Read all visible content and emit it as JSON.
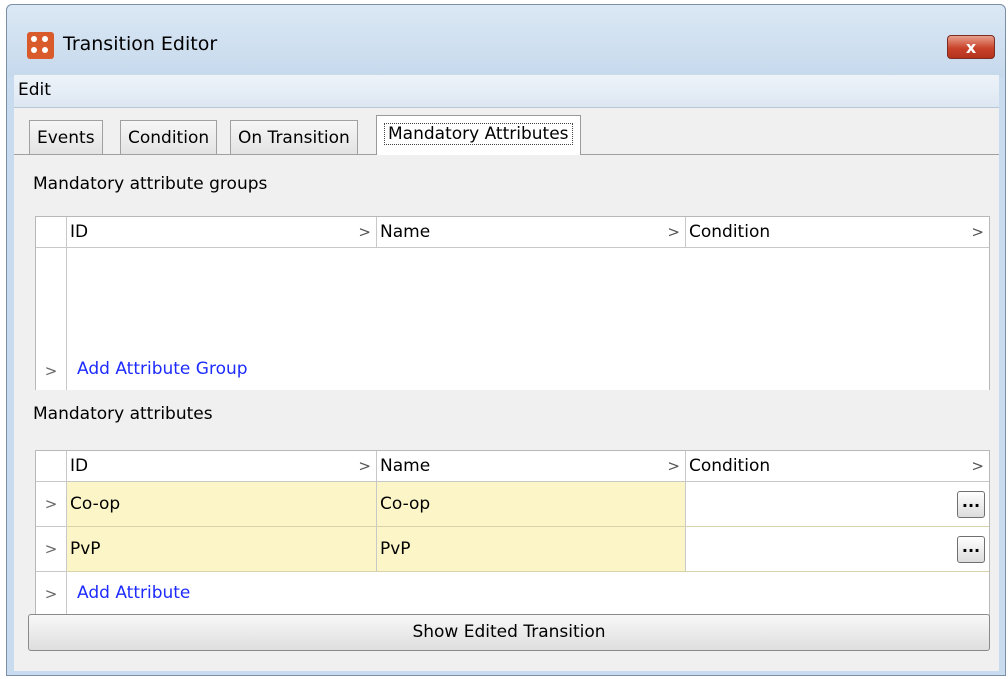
{
  "window": {
    "title": "Transition Editor",
    "close_label": "x"
  },
  "menu": {
    "edit": "Edit"
  },
  "tabs": [
    "Events",
    "Condition",
    "On Transition",
    "Mandatory Attributes"
  ],
  "groups": {
    "label": "Mandatory attribute groups",
    "columns": [
      "ID",
      "Name",
      "Condition"
    ],
    "add_label": "Add Attribute Group"
  },
  "attributes": {
    "label": "Mandatory attributes",
    "columns": [
      "ID",
      "Name",
      "Condition"
    ],
    "rows": [
      {
        "id": "Co-op",
        "name": "Co-op",
        "condition": ""
      },
      {
        "id": "PvP",
        "name": "PvP",
        "condition": ""
      }
    ],
    "add_label": "Add Attribute"
  },
  "chevron": ">",
  "ellipsis": "...",
  "show_button": "Show Edited Transition",
  "colors": {
    "highlight_row": "#fbf5c8",
    "link": "#1d2bff",
    "close_button": "#c9432b"
  }
}
